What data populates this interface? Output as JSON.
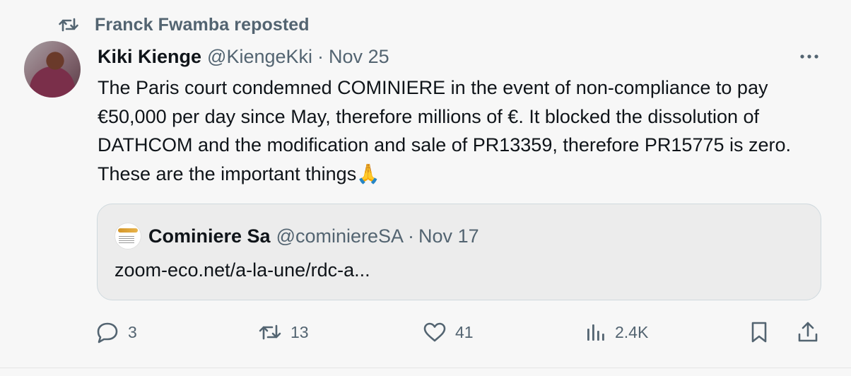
{
  "repost": {
    "text": "Franck Fwamba reposted",
    "icon": "repost-icon"
  },
  "post": {
    "author_name": "Kiki Kienge",
    "author_handle": "@KiengeKki",
    "separator": "·",
    "date": "Nov 25",
    "text": "The Paris court condemned COMINIERE in the event of non-compliance to pay €50,000 per day since May, therefore millions of €. It blocked the dissolution of DATHCOM and the modification and sale of PR13359, therefore PR15775 is zero. These are the important things🙏",
    "more_icon": "more-icon"
  },
  "quote": {
    "author_name": "Cominiere Sa",
    "author_handle": "@cominiereSA",
    "separator": "·",
    "date": "Nov 17",
    "link_text": "zoom-eco.net/a-la-une/rdc-a..."
  },
  "actions": {
    "replies": "3",
    "reposts": "13",
    "likes": "41",
    "views": "2.4K"
  },
  "colors": {
    "text": "#0f1419",
    "secondary": "#536471",
    "border": "#cfd9de",
    "background": "#f7f7f7"
  }
}
